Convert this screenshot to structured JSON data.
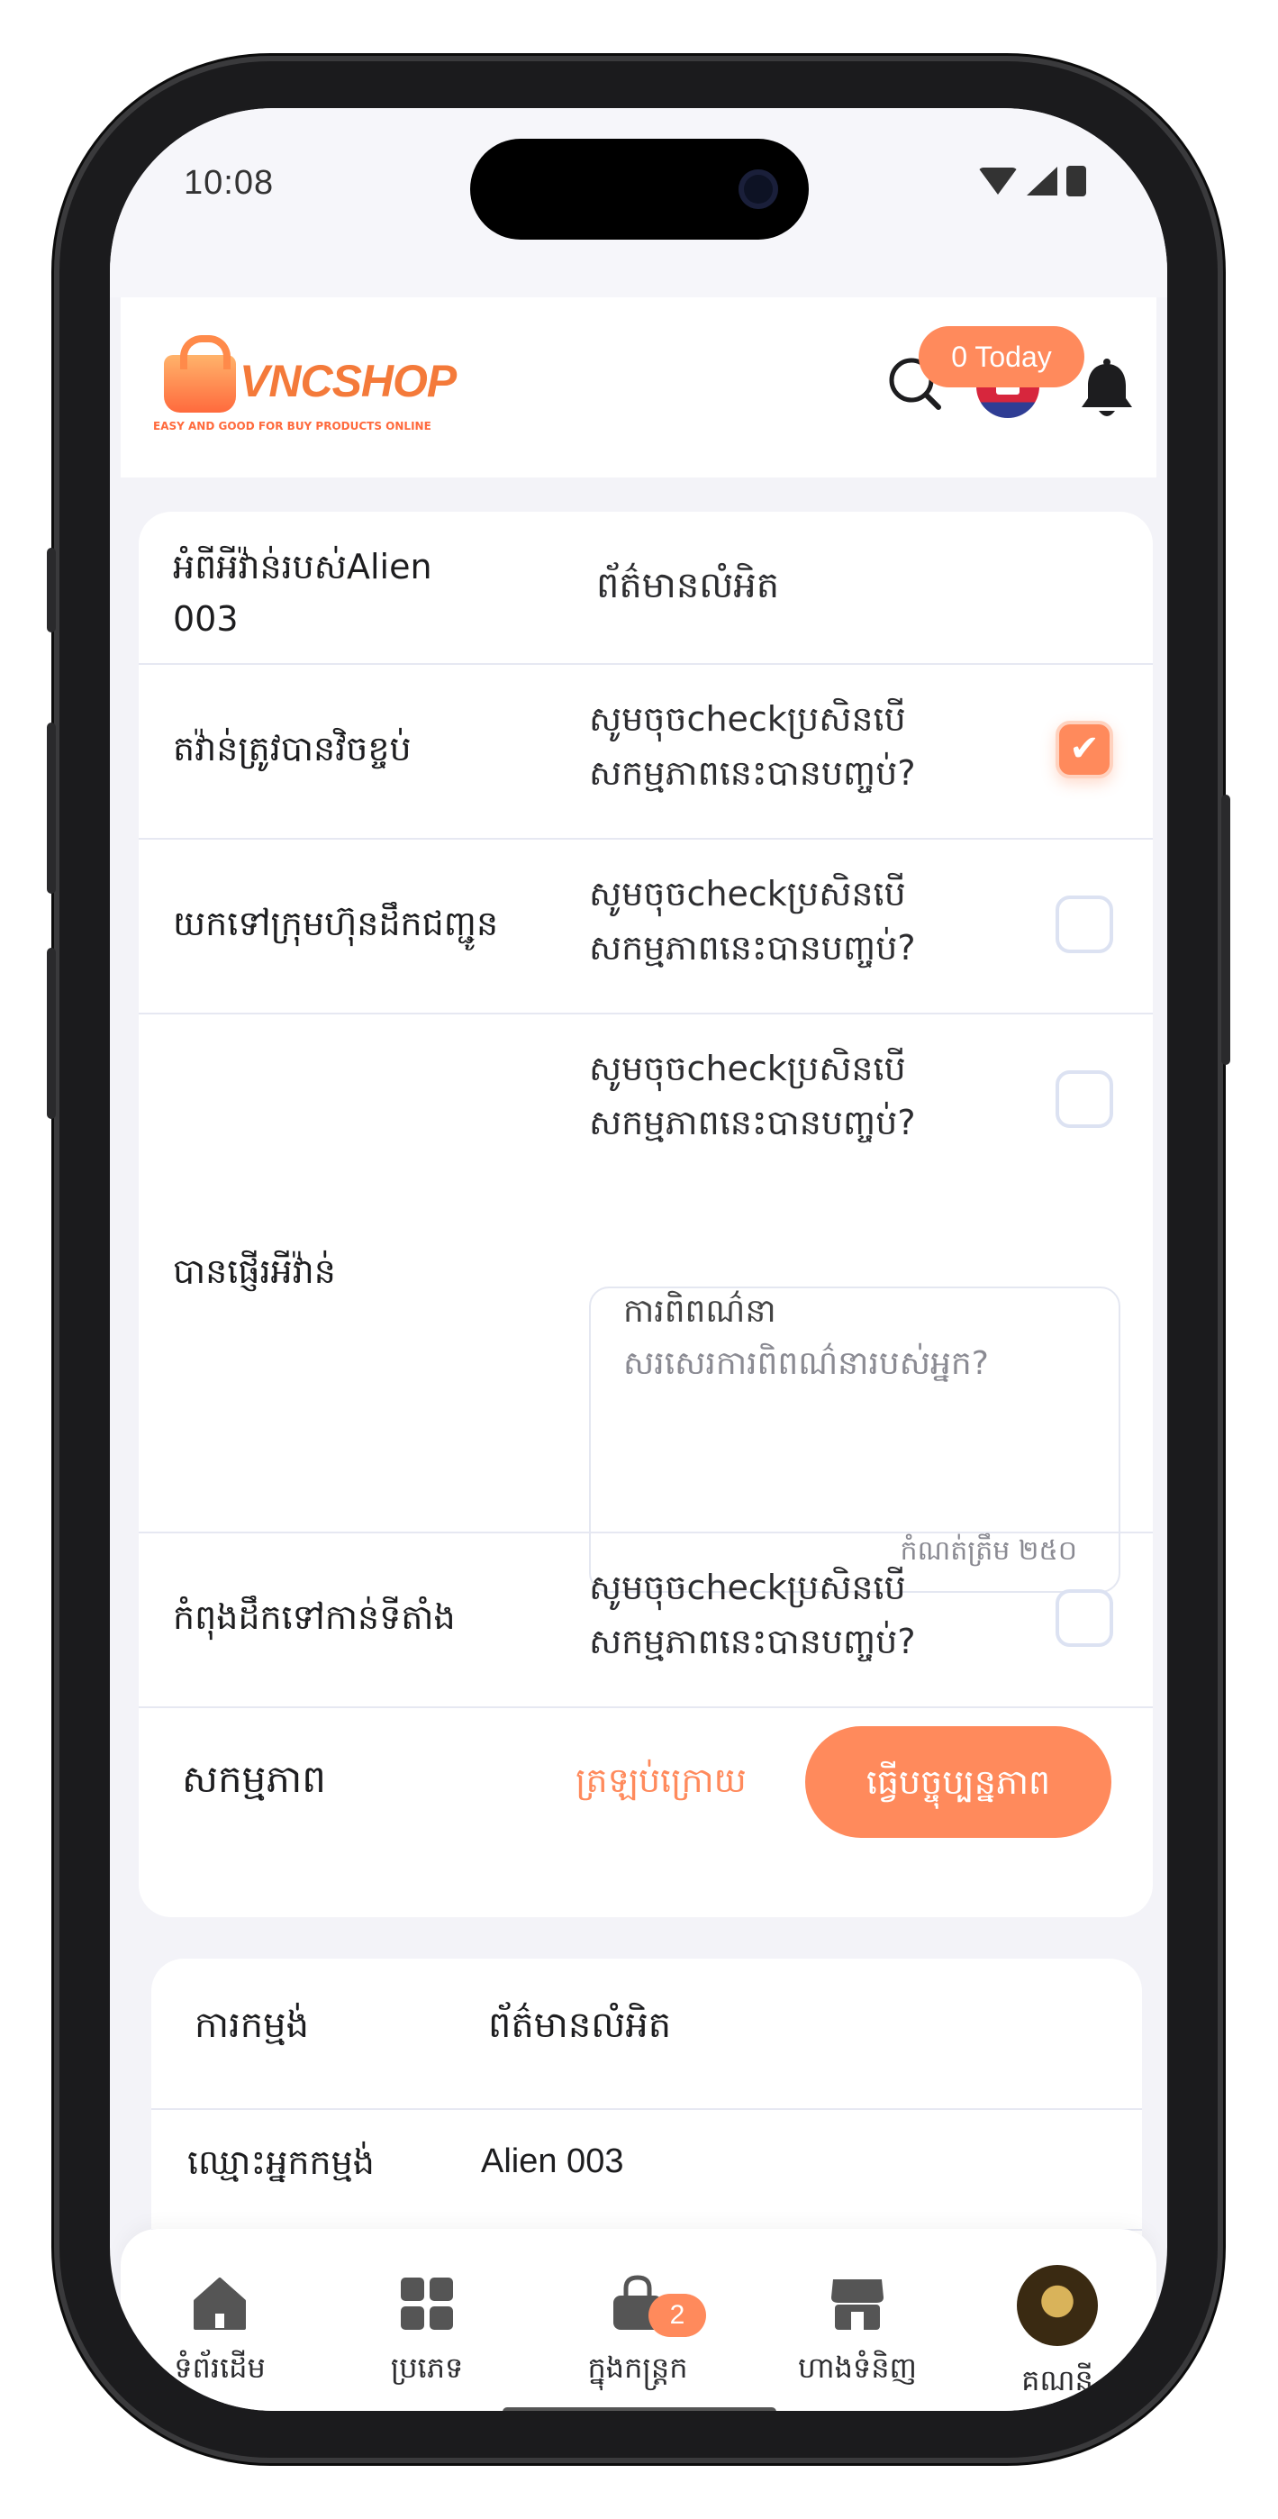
{
  "status_bar": {
    "time": "10:08"
  },
  "header": {
    "logo_text": "VNCSHOP",
    "logo_tagline": "EASY AND GOOD FOR BUY PRODUCTS ONLINE",
    "today_badge": "0 Today"
  },
  "event_card": {
    "title": "អំពីអីវ៉ាន់របស់Alien 003",
    "details_header": "ព័ត៌មានលំអិត",
    "rows": [
      {
        "label": "តវ៉ាន់ត្រូវបានវិចខ្ចប់",
        "line1": "សូមចុចcheckប្រសិនបើ",
        "line2": "សកម្មភាពនេះបានបញ្ចប់?",
        "checked": true
      },
      {
        "label": "យកទៅក្រុមហ៊ុនដឹកជញ្ជូន",
        "line1": "សូមចុចcheckប្រសិនបើ",
        "line2": "សកម្មភាពនេះបានបញ្ចប់?",
        "checked": false
      },
      {
        "label": "បានផ្ញើរអីវ៉ាន់",
        "line1": "សូមចុចcheckប្រសិនបើ",
        "line2": "សកម្មភាពនេះបានបញ្ចប់?",
        "checked": false
      },
      {
        "label": "កំពុងដឹកទៅកាន់ទីតាំង",
        "line1": "សូមចុចcheckប្រសិនបើ",
        "line2": "សកម្មភាពនេះបានបញ្ចប់?",
        "checked": false
      }
    ],
    "comment": {
      "label": "ការពិពណ៌នា",
      "placeholder": "សរសេរការពិពណ៌នារបស់អ្នក?",
      "limit": "កំណត់ត្រឹម ២៥០"
    },
    "action_label": "សកម្មភាព",
    "later_button": "ត្រឡប់ក្រោយ",
    "update_button": "ធ្វើបច្ចុប្បន្នភាព"
  },
  "order_card": {
    "header_left": "ការកម្មង់",
    "header_right": "ព័ត៌មានលំអិត",
    "customer_label": "ឈ្មោះអ្នកកម្មង់",
    "customer_value": "Alien 003"
  },
  "bottom_nav": {
    "items": [
      {
        "label": "ទំព័រដើម",
        "icon": "home-icon"
      },
      {
        "label": "ប្រភេទ",
        "icon": "grid-icon"
      },
      {
        "label": "ក្នុងកន្ត្រក",
        "icon": "bag-icon",
        "badge": "2"
      },
      {
        "label": "ហាងទំនិញ",
        "icon": "store-icon"
      },
      {
        "label": "គណនី",
        "icon": "avatar"
      }
    ]
  },
  "colors": {
    "accent": "#ff8a5c",
    "background": "#f3f3f8",
    "text": "#1d1d1f"
  }
}
